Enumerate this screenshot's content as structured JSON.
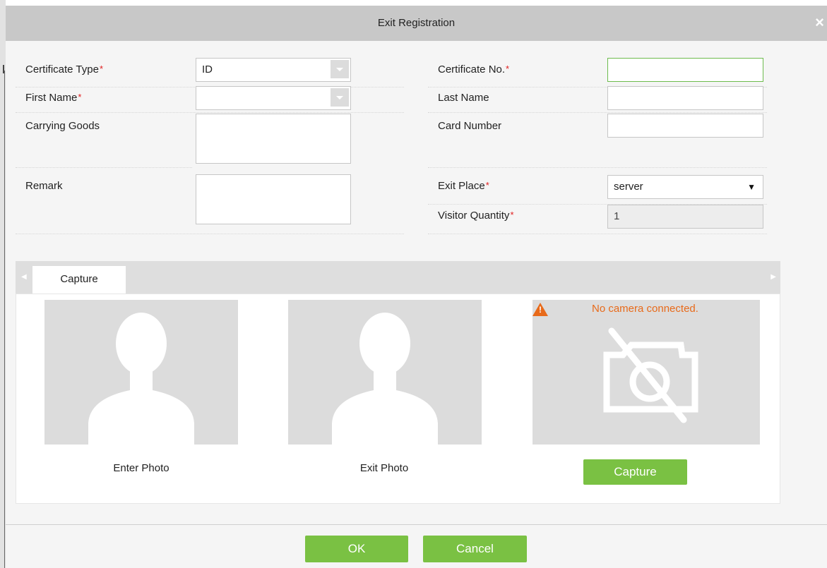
{
  "dialog": {
    "title": "Exit Registration",
    "close_symbol": "×"
  },
  "form": {
    "certificate_type": {
      "label": "Certificate Type",
      "required": "*",
      "value": "ID"
    },
    "first_name": {
      "label": "First Name",
      "required": "*",
      "value": ""
    },
    "carrying_goods": {
      "label": "Carrying Goods",
      "value": ""
    },
    "remark": {
      "label": "Remark",
      "value": ""
    },
    "certificate_no": {
      "label": "Certificate No.",
      "required": "*",
      "value": ""
    },
    "last_name": {
      "label": "Last Name",
      "value": ""
    },
    "card_number": {
      "label": "Card Number",
      "value": ""
    },
    "exit_place": {
      "label": "Exit Place",
      "required": "*",
      "value": "server",
      "arrow": "▼"
    },
    "visitor_quantity": {
      "label": "Visitor Quantity",
      "required": "*",
      "value": "1"
    }
  },
  "capture_section": {
    "tab_label": "Capture",
    "tab_left_arrow": "◀",
    "tab_right_arrow": "▶",
    "enter_photo_label": "Enter Photo",
    "exit_photo_label": "Exit Photo",
    "camera_warning": "No camera connected.",
    "capture_button": "Capture"
  },
  "footer": {
    "ok_label": "OK",
    "cancel_label": "Cancel"
  },
  "colors": {
    "accent_green": "#7ac143",
    "warning_orange": "#e86a1a",
    "title_bar": "#c8c8c8",
    "photo_placeholder": "#dcdcdc"
  },
  "icons": [
    "close-icon",
    "dropdown-arrow-icon",
    "person-silhouette-icon",
    "warning-icon",
    "no-camera-icon"
  ]
}
